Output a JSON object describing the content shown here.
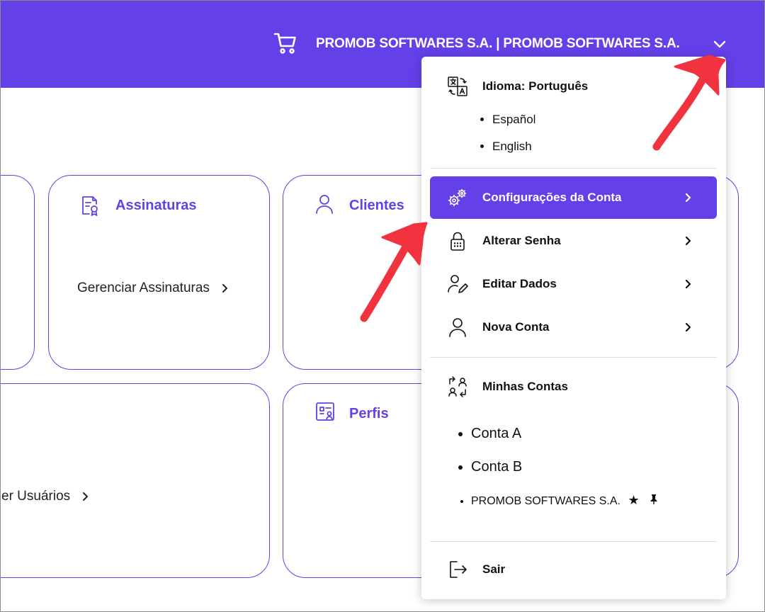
{
  "header": {
    "company_label": "PROMOB SOFTWARES S.A. | PROMOB SOFTWARES S.A.",
    "brand_color": "#6440e8"
  },
  "cards": [
    {
      "title": "",
      "link": ""
    },
    {
      "title": "Assinaturas",
      "link": "Gerenciar Assinaturas"
    },
    {
      "title": "Clientes",
      "link": ""
    },
    {
      "title": "",
      "link": "er Usuários"
    },
    {
      "title": "Perfis",
      "link": ""
    }
  ],
  "menu": {
    "language_label": "Idioma: Português",
    "languages": [
      "Español",
      "English"
    ],
    "account_settings": "Configurações da Conta",
    "change_password": "Alterar Senha",
    "edit_data": "Editar Dados",
    "new_account": "Nova Conta",
    "my_accounts": "Minhas Contas",
    "accounts": [
      "Conta A",
      "Conta B"
    ],
    "pinned_account": "PROMOB SOFTWARES S.A.",
    "logout": "Sair"
  },
  "annotation_color": "#f0333e"
}
